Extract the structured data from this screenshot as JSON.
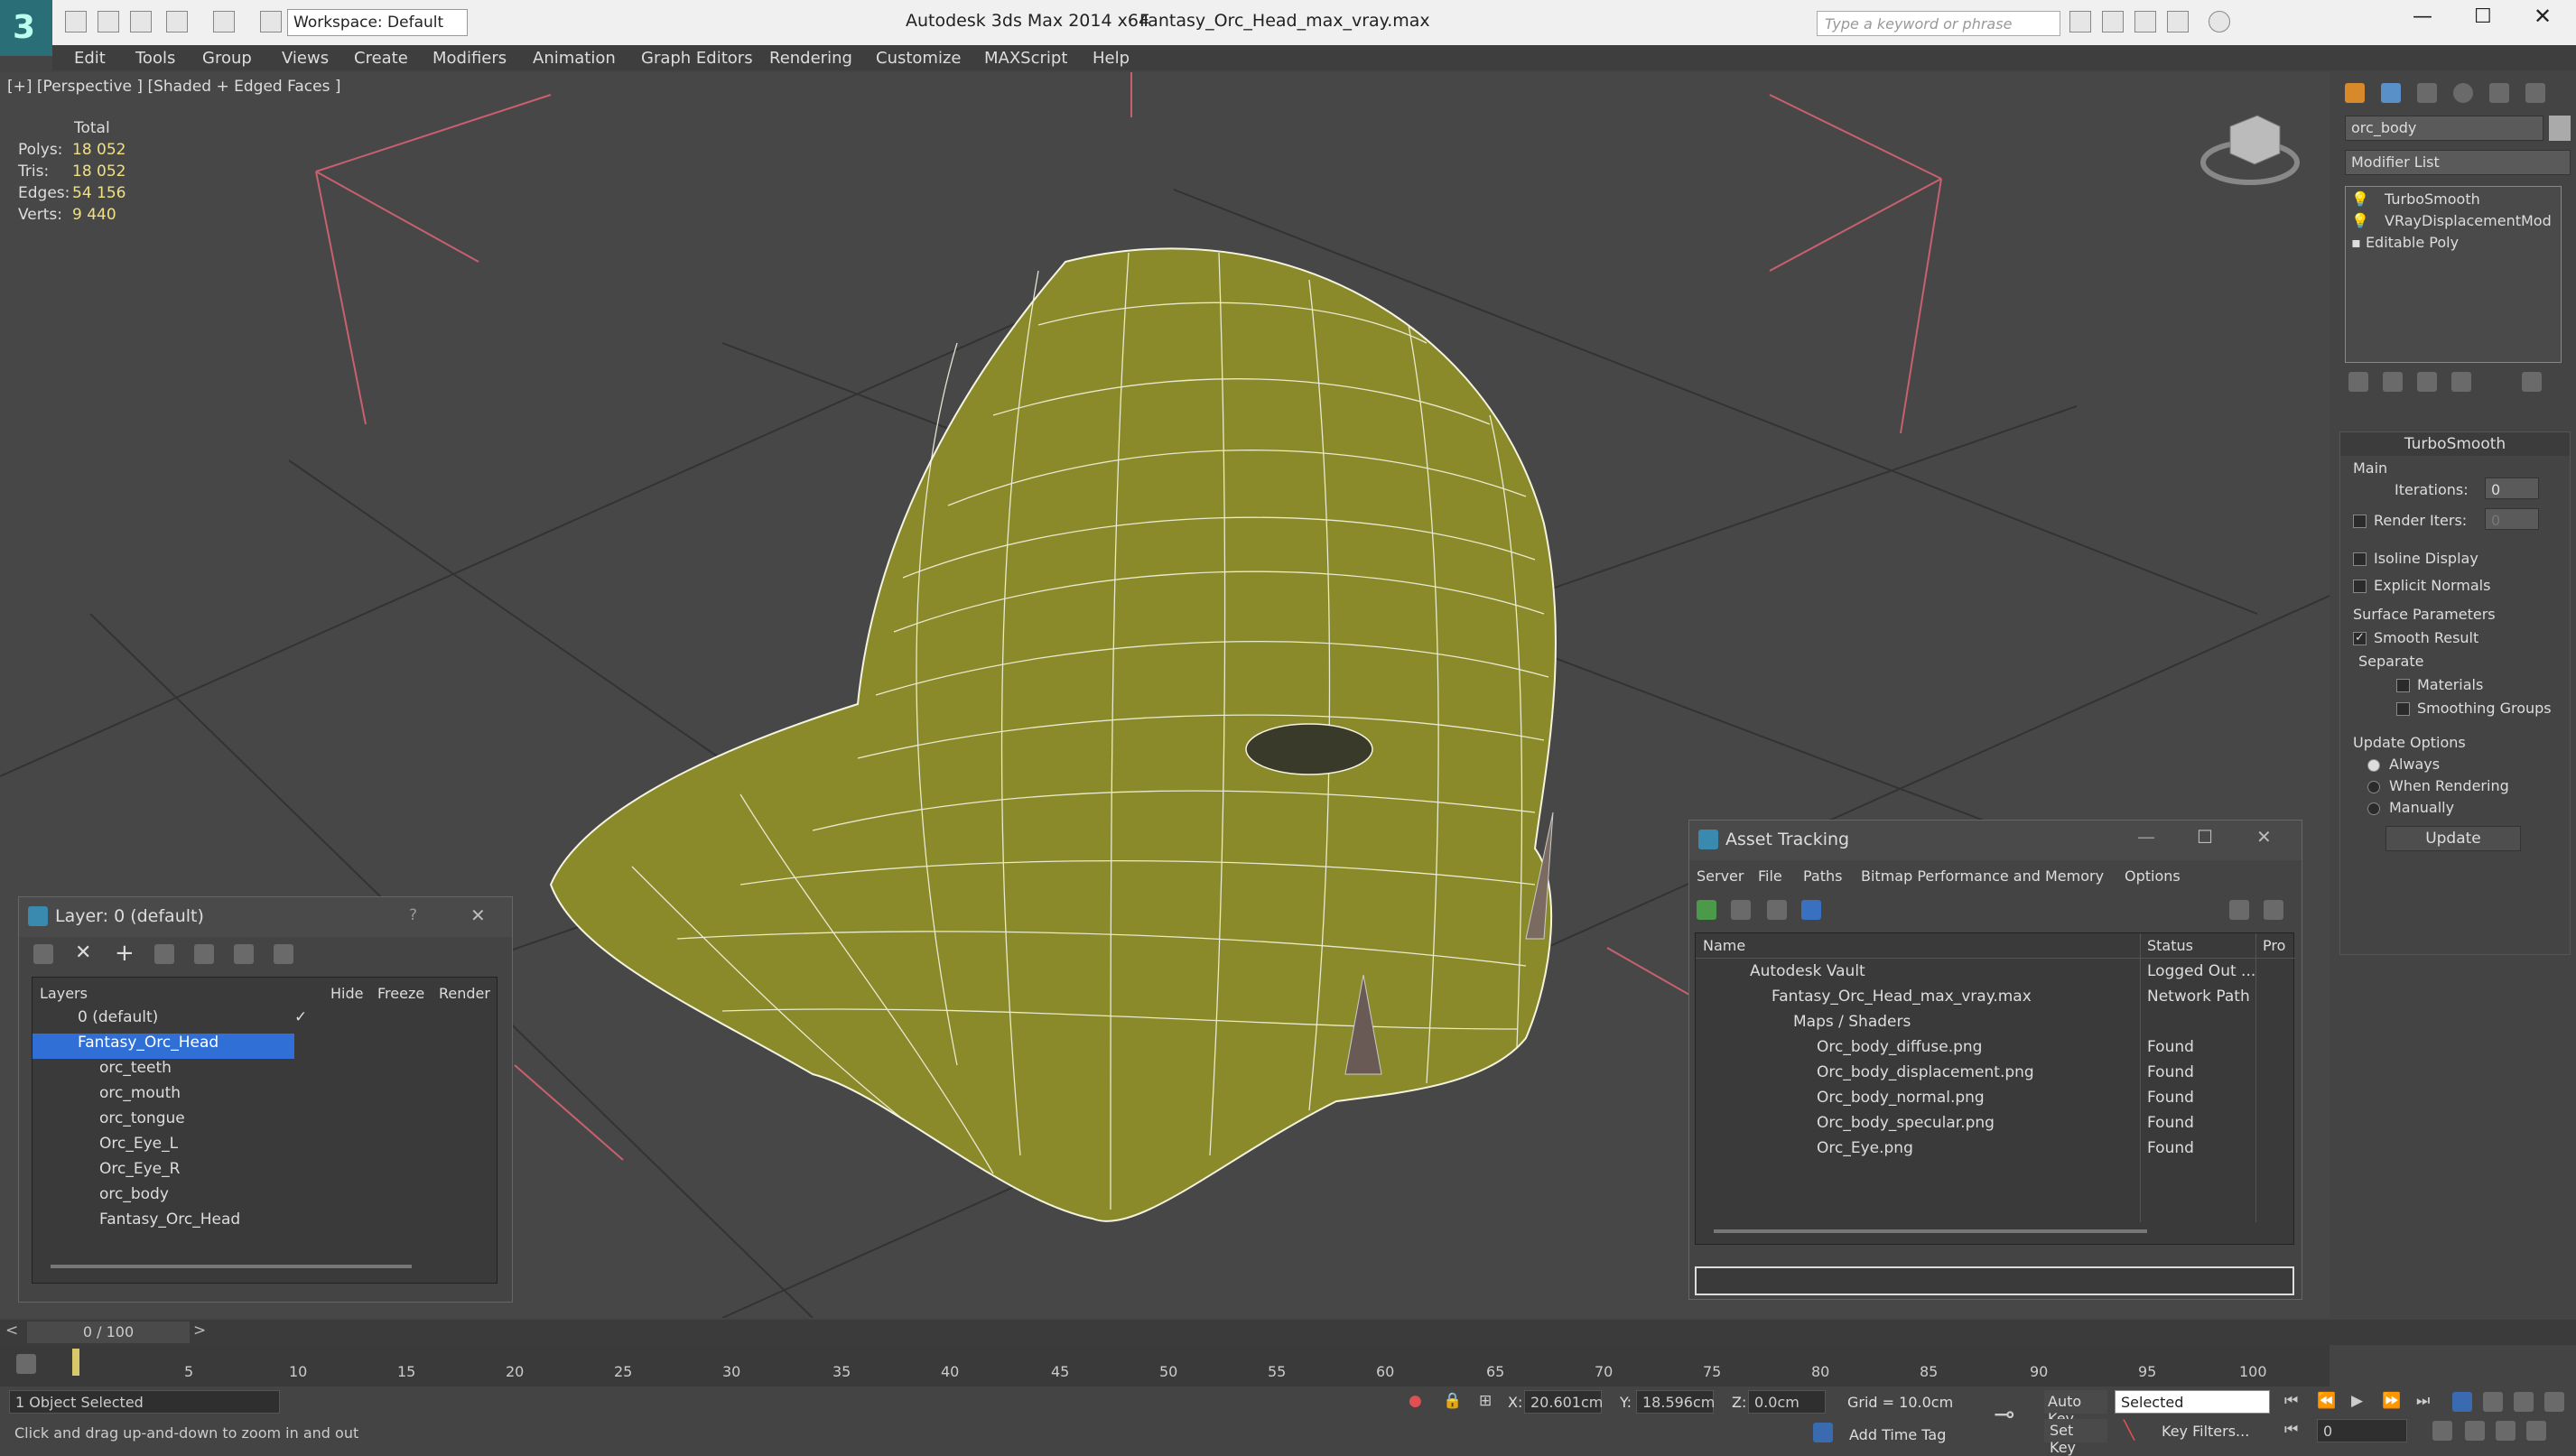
{
  "titlebar": {
    "app_title": "Autodesk 3ds Max  2014 x64",
    "file_name": "Fantasy_Orc_Head_max_vray.max",
    "workspace": "Workspace: Default",
    "search_placeholder": "Type a keyword or phrase"
  },
  "menu": [
    "Edit",
    "Tools",
    "Group",
    "Views",
    "Create",
    "Modifiers",
    "Animation",
    "Graph Editors",
    "Rendering",
    "Customize",
    "MAXScript",
    "Help"
  ],
  "viewport": {
    "label": "[+] [Perspective ] [Shaded + Edged Faces ]",
    "stats": {
      "header": "Total",
      "polys_label": "Polys:",
      "polys": "18 052",
      "tris_label": "Tris:",
      "tris": "18 052",
      "edges_label": "Edges:",
      "edges": "54 156",
      "verts_label": "Verts:",
      "verts": "9 440"
    },
    "model_color": "#8a8a2a",
    "wire_color": "#ffffff"
  },
  "command_panel": {
    "object_name": "orc_body",
    "modifier_list": "Modifier List",
    "stack": [
      "TurboSmooth",
      "VRayDisplacementMod",
      "Editable Poly"
    ],
    "rollout_title": "TurboSmooth",
    "main_label": "Main",
    "iterations_label": "Iterations:",
    "iterations": "0",
    "render_iters_label": "Render Iters:",
    "render_iters": "0",
    "isoline": "Isoline Display",
    "explicit_normals": "Explicit Normals",
    "surface_params": "Surface Parameters",
    "smooth_result": "Smooth Result",
    "separate": "Separate",
    "materials": "Materials",
    "smoothing_groups": "Smoothing Groups",
    "update_options": "Update Options",
    "always": "Always",
    "when_rendering": "When Rendering",
    "manually": "Manually",
    "update_btn": "Update"
  },
  "layer_window": {
    "title": "Layer: 0 (default)",
    "help": "?",
    "columns": [
      "Layers",
      "Hide",
      "Freeze",
      "Render"
    ],
    "rows": [
      "0 (default)",
      "Fantasy_Orc_Head",
      "orc_teeth",
      "orc_mouth",
      "orc_tongue",
      "Orc_Eye_L",
      "Orc_Eye_R",
      "orc_body",
      "Fantasy_Orc_Head"
    ]
  },
  "asset_window": {
    "title": "Asset Tracking",
    "menu": [
      "Server",
      "File",
      "Paths",
      "Bitmap Performance and Memory",
      "Options"
    ],
    "columns": [
      "Name",
      "Status",
      "Pro"
    ],
    "rows": [
      {
        "name": "Autodesk Vault",
        "status": "Logged Out ..."
      },
      {
        "name": "Fantasy_Orc_Head_max_vray.max",
        "status": "Network Path"
      },
      {
        "name": "Maps / Shaders",
        "status": ""
      },
      {
        "name": "Orc_body_diffuse.png",
        "status": "Found"
      },
      {
        "name": "Orc_body_displacement.png",
        "status": "Found"
      },
      {
        "name": "Orc_body_normal.png",
        "status": "Found"
      },
      {
        "name": "Orc_body_specular.png",
        "status": "Found"
      },
      {
        "name": "Orc_Eye.png",
        "status": "Found"
      }
    ]
  },
  "timeline": {
    "frame": "0 / 100",
    "ticks": [
      "5",
      "10",
      "15",
      "20",
      "25",
      "30",
      "35",
      "40",
      "45",
      "50",
      "55",
      "60",
      "65",
      "70",
      "75",
      "80",
      "85",
      "90",
      "95",
      "100"
    ]
  },
  "status": {
    "selected": "1 Object Selected",
    "prompt": "Click and drag up-and-down to zoom in and out",
    "x_label": "X:",
    "x": "20.601cm",
    "y_label": "Y:",
    "y": "18.596cm",
    "z_label": "Z:",
    "z": "0.0cm",
    "grid": "Grid = 10.0cm",
    "auto_key": "Auto Key",
    "set_key": "Set Key",
    "selected_dd": "Selected",
    "key_filters": "Key Filters...",
    "add_time_tag": "Add Time Tag",
    "frame_field": "0"
  }
}
